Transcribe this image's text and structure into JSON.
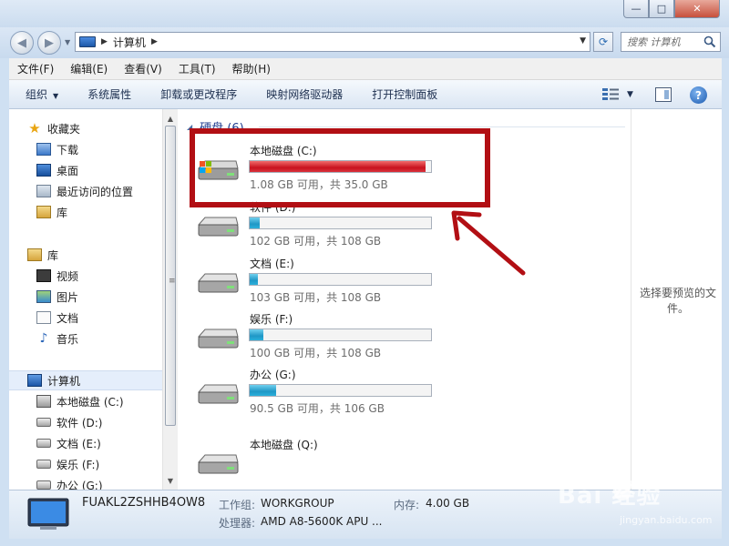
{
  "window": {
    "controls": {
      "minimize": "—",
      "maximize": "□",
      "close": "✕"
    }
  },
  "address": {
    "path": [
      "计算机"
    ],
    "search_placeholder": "搜索 计算机"
  },
  "menu": [
    "文件(F)",
    "编辑(E)",
    "查看(V)",
    "工具(T)",
    "帮助(H)"
  ],
  "commands": {
    "organize": "组织",
    "items": [
      "系统属性",
      "卸载或更改程序",
      "映射网络驱动器",
      "打开控制面板"
    ]
  },
  "sidebar": {
    "favorites": {
      "label": "收藏夹",
      "icon": "star-icon",
      "items": [
        {
          "label": "下载",
          "icon": "downloads-folder-icon"
        },
        {
          "label": "桌面",
          "icon": "desktop-icon"
        },
        {
          "label": "最近访问的位置",
          "icon": "recent-places-icon"
        },
        {
          "label": "库",
          "icon": "library-icon"
        }
      ]
    },
    "libraries": {
      "label": "库",
      "icon": "library-icon",
      "items": [
        {
          "label": "视频",
          "icon": "video-icon"
        },
        {
          "label": "图片",
          "icon": "pictures-icon"
        },
        {
          "label": "文档",
          "icon": "documents-icon"
        },
        {
          "label": "音乐",
          "icon": "music-icon"
        }
      ]
    },
    "computer": {
      "label": "计算机",
      "icon": "computer-icon",
      "items": [
        {
          "label": "本地磁盘 (C:)",
          "icon": "system-drive-icon"
        },
        {
          "label": "软件 (D:)",
          "icon": "drive-icon"
        },
        {
          "label": "文档 (E:)",
          "icon": "drive-icon"
        },
        {
          "label": "娱乐 (F:)",
          "icon": "drive-icon"
        },
        {
          "label": "办公 (G:)",
          "icon": "drive-icon"
        }
      ]
    }
  },
  "content": {
    "group_title": "硬盘 (6)",
    "drives": [
      {
        "name": "本地磁盘 (C:)",
        "info": "1.08 GB 可用，共 35.0 GB",
        "used_fraction": 0.969,
        "full": true,
        "system": true
      },
      {
        "name": "软件 (D:)",
        "info": "102 GB 可用，共 108 GB",
        "used_fraction": 0.056,
        "full": false,
        "system": false
      },
      {
        "name": "文档 (E:)",
        "info": "103 GB 可用，共 108 GB",
        "used_fraction": 0.046,
        "full": false,
        "system": false
      },
      {
        "name": "娱乐 (F:)",
        "info": "100 GB 可用，共 108 GB",
        "used_fraction": 0.074,
        "full": false,
        "system": false
      },
      {
        "name": "办公 (G:)",
        "info": "90.5 GB 可用，共 106 GB",
        "used_fraction": 0.146,
        "full": false,
        "system": false
      },
      {
        "name": "本地磁盘 (Q:)",
        "info": "",
        "used_fraction": null,
        "full": false,
        "system": false
      }
    ],
    "preview_text": "选择要预览的文件。"
  },
  "details": {
    "computer_name": "FUAKL2ZSHHB4OW8",
    "workgroup_label": "工作组:",
    "workgroup_value": "WORKGROUP",
    "memory_label": "内存:",
    "memory_value": "4.00 GB",
    "processor_label": "处理器:",
    "processor_value": "AMD A8-5600K APU ..."
  },
  "watermark": {
    "brand": "Bai 经验",
    "url": "jingyan.baidu.com"
  },
  "colors": {
    "highlight": "#b20f14",
    "full_bar": "#c8121e",
    "bar": "#1f97c6",
    "link": "#1d3b8f"
  }
}
